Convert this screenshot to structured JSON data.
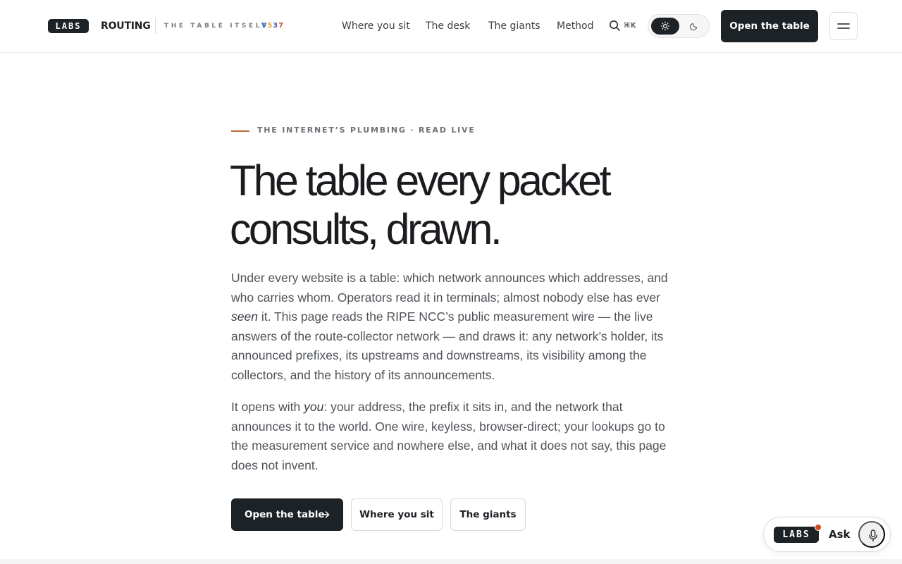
{
  "header": {
    "logo_text": "LABS",
    "brand": "ROUTING",
    "tagline": "THE TABLE ITSELF",
    "version": {
      "prefix": "V",
      "d1": "5",
      "d2": "3",
      "d3": "7"
    },
    "nav": [
      "Where you sit",
      "The desk",
      "The giants",
      "Method"
    ],
    "search_icon": "search-icon",
    "search_shortcut": "⌘K",
    "theme_toggle": {
      "options": [
        "light",
        "dark"
      ],
      "selected": "light"
    },
    "cta": "Open the table",
    "menu_icon": "hamburger-menu-icon"
  },
  "hero": {
    "eyebrow": "THE INTERNET’S PLUMBING · READ LIVE",
    "title_line1": "The table every packet",
    "title_line2": "consults, drawn.",
    "p1_a": "Under every website is a table: which network announces which addresses, and who carries whom. Operators read it in terminals; almost nobody else has ever ",
    "p1_em": "seen",
    "p1_b": " it. This page reads the RIPE NCC’s public measurement wire — the live answers of the route-collector network — and draws it: any network’s holder, its announced prefixes, its upstreams and downstreams, its visibility among the collectors, and the history of its announcements.",
    "p2_a": "It opens with ",
    "p2_em": "you",
    "p2_b": ": your address, the prefix it sits in, and the network that announces it to the world. One wire, keyless, browser-direct; your lookups go to the measurement service and nowhere else, and what it does not say, this page does not invent.",
    "buttons": {
      "primary": "Open the table",
      "secondary": "Where you sit",
      "tertiary": "The giants"
    }
  },
  "ask": {
    "logo_text": "LABS",
    "label": "Ask",
    "mic_icon": "microphone-icon"
  },
  "colors": {
    "ink": "#1d2226",
    "accent_line": "#b8693a",
    "notification_dot": "#d2491f"
  }
}
